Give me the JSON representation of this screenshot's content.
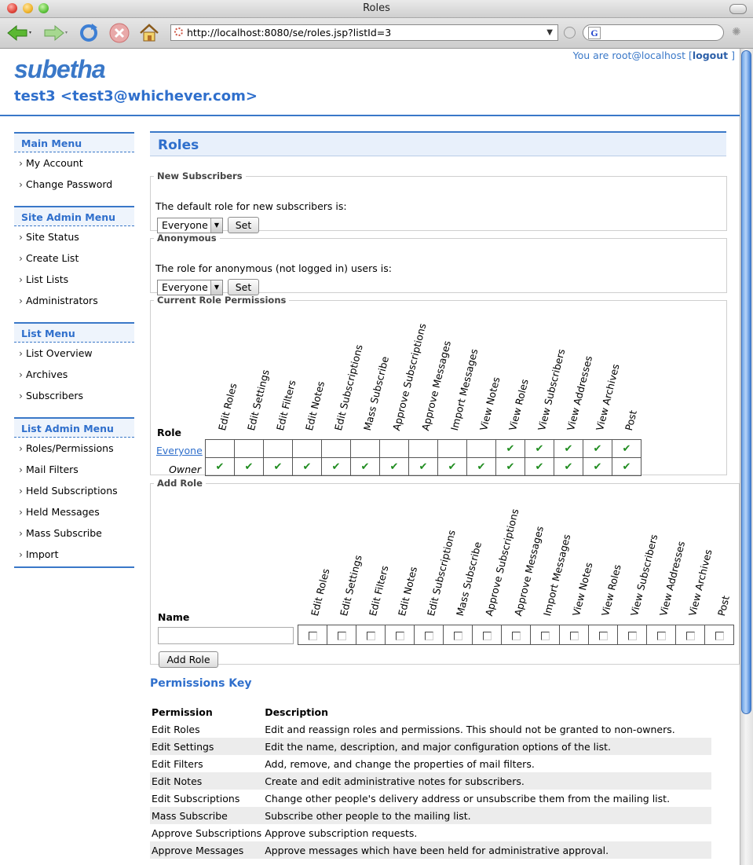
{
  "window": {
    "title": "Roles"
  },
  "browser": {
    "url": "http://localhost:8080/se/roles.jsp?listId=3"
  },
  "header": {
    "logo_text": "subetha",
    "list_name": "test3 <test3@whichever.com>",
    "user_prefix": "You are root@localhost [",
    "logout": "logout",
    "user_suffix": " ]"
  },
  "sidebar": {
    "main_menu": {
      "title": "Main Menu",
      "items": [
        "My Account",
        "Change Password"
      ]
    },
    "site_admin_menu": {
      "title": "Site Admin Menu",
      "items": [
        "Site Status",
        "Create List",
        "List Lists",
        "Administrators"
      ]
    },
    "list_menu": {
      "title": "List Menu",
      "items": [
        "List Overview",
        "Archives",
        "Subscribers"
      ]
    },
    "list_admin_menu": {
      "title": "List Admin Menu",
      "items": [
        "Roles/Permissions",
        "Mail Filters",
        "Held Subscriptions",
        "Held Messages",
        "Mass Subscribe",
        "Import"
      ]
    }
  },
  "page": {
    "title": "Roles"
  },
  "new_subscribers": {
    "legend": "New Subscribers",
    "label": "The default role for new subscribers is:",
    "selected": "Everyone",
    "button": "Set"
  },
  "anonymous": {
    "legend": "Anonymous",
    "label": "The role for anonymous (not logged in) users is:",
    "selected": "Everyone",
    "button": "Set"
  },
  "current_permissions": {
    "legend": "Current Role Permissions",
    "role_header": "Role",
    "columns": [
      "Edit Roles",
      "Edit Settings",
      "Edit Filters",
      "Edit Notes",
      "Edit Subscriptions",
      "Mass Subscribe",
      "Approve Subscriptions",
      "Approve Messages",
      "Import Messages",
      "View Notes",
      "View Roles",
      "View Subscribers",
      "View Addresses",
      "View Archives",
      "Post"
    ],
    "rows": [
      {
        "role": "Everyone",
        "checks": [
          false,
          false,
          false,
          false,
          false,
          false,
          false,
          false,
          false,
          false,
          true,
          true,
          true,
          true,
          true
        ]
      },
      {
        "role": "Owner",
        "checks": [
          true,
          true,
          true,
          true,
          true,
          true,
          true,
          true,
          true,
          true,
          true,
          true,
          true,
          true,
          true
        ]
      }
    ]
  },
  "add_role": {
    "legend": "Add Role",
    "name_header": "Name",
    "name_value": "",
    "button": "Add Role",
    "columns": [
      "Edit Roles",
      "Edit Settings",
      "Edit Filters",
      "Edit Notes",
      "Edit Subscriptions",
      "Mass Subscribe",
      "Approve Subscriptions",
      "Approve Messages",
      "Import Messages",
      "View Notes",
      "View Roles",
      "View Subscribers",
      "View Addresses",
      "View Archives",
      "Post"
    ]
  },
  "permissions_key": {
    "title": "Permissions Key",
    "headers": [
      "Permission",
      "Description"
    ],
    "rows": [
      [
        "Edit Roles",
        "Edit and reassign roles and permissions. This should not be granted to non-owners."
      ],
      [
        "Edit Settings",
        "Edit the name, description, and major configuration options of the list."
      ],
      [
        "Edit Filters",
        "Add, remove, and change the properties of mail filters."
      ],
      [
        "Edit Notes",
        "Create and edit administrative notes for subscribers."
      ],
      [
        "Edit Subscriptions",
        "Change other people's delivery address or unsubscribe them from the mailing list."
      ],
      [
        "Mass Subscribe",
        "Subscribe other people to the mailing list."
      ],
      [
        "Approve Subscriptions",
        "Approve subscription requests."
      ],
      [
        "Approve Messages",
        "Approve messages which have been held for administrative approval."
      ]
    ]
  },
  "colors": {
    "accent": "#3a78c8",
    "check": "#1e8b1e"
  }
}
